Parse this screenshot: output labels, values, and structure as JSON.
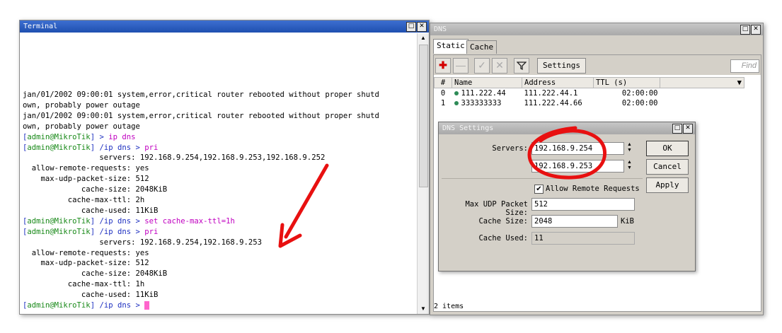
{
  "terminal": {
    "title": "Terminal",
    "lines": [
      {
        "kind": "text",
        "text": "jan/01/2002 09:00:01 system,error,critical router rebooted without proper shutd"
      },
      {
        "kind": "text",
        "text": "own, probably power outage"
      },
      {
        "kind": "text",
        "text": "jan/01/2002 09:00:01 system,error,critical router rebooted without proper shutd"
      },
      {
        "kind": "text",
        "text": "own, probably power outage"
      },
      {
        "kind": "prompt",
        "user": "admin@MikroTik",
        "path": "",
        "cmd": "ip dns"
      },
      {
        "kind": "prompt",
        "user": "admin@MikroTik",
        "path": "/ip dns",
        "cmd": "pri"
      },
      {
        "kind": "text",
        "text": "                 servers: 192.168.9.254,192.168.9.253,192.168.9.252"
      },
      {
        "kind": "text",
        "text": "  allow-remote-requests: yes"
      },
      {
        "kind": "text",
        "text": "    max-udp-packet-size: 512"
      },
      {
        "kind": "text",
        "text": "             cache-size: 2048KiB"
      },
      {
        "kind": "text",
        "text": "          cache-max-ttl: 2h"
      },
      {
        "kind": "text",
        "text": "             cache-used: 11KiB"
      },
      {
        "kind": "prompt",
        "user": "admin@MikroTik",
        "path": "/ip dns",
        "cmd": "set cache-max-ttl=1h"
      },
      {
        "kind": "prompt",
        "user": "admin@MikroTik",
        "path": "/ip dns",
        "cmd": "pri"
      },
      {
        "kind": "text",
        "text": "                 servers: 192.168.9.254,192.168.9.253"
      },
      {
        "kind": "text",
        "text": "  allow-remote-requests: yes"
      },
      {
        "kind": "text",
        "text": "    max-udp-packet-size: 512"
      },
      {
        "kind": "text",
        "text": "             cache-size: 2048KiB"
      },
      {
        "kind": "text",
        "text": "          cache-max-ttl: 1h"
      },
      {
        "kind": "text",
        "text": "             cache-used: 11KiB"
      },
      {
        "kind": "prompt",
        "user": "admin@MikroTik",
        "path": "/ip dns",
        "cmd": "",
        "cursor": true
      }
    ]
  },
  "dns": {
    "title": "DNS",
    "tabs": [
      "Static",
      "Cache"
    ],
    "settings_button": "Settings",
    "find_placeholder": "Find",
    "columns": [
      "#",
      "Name",
      "Address",
      "TTL (s)"
    ],
    "rows": [
      {
        "num": "0",
        "name": "111.222.44",
        "address": "111.222.44.1",
        "ttl": "02:00:00"
      },
      {
        "num": "1",
        "name": "333333333",
        "address": "111.222.44.66",
        "ttl": "02:00:00"
      }
    ],
    "item_count": "2 items"
  },
  "dialog": {
    "title": "DNS Settings",
    "servers_label": "Servers:",
    "server1": "192.168.9.254",
    "server2": "192.168.9.253",
    "allow_remote_label": "Allow Remote Requests",
    "max_udp_label": "Max UDP Packet Size:",
    "max_udp_value": "512",
    "cache_size_label": "Cache Size:",
    "cache_size_value": "2048",
    "cache_size_unit": "KiB",
    "cache_used_label": "Cache Used:",
    "cache_used_value": "11",
    "ok_label": "OK",
    "cancel_label": "Cancel",
    "apply_label": "Apply"
  },
  "annotation_colors": {
    "arrow": "#e81010",
    "circle": "#e81010"
  }
}
